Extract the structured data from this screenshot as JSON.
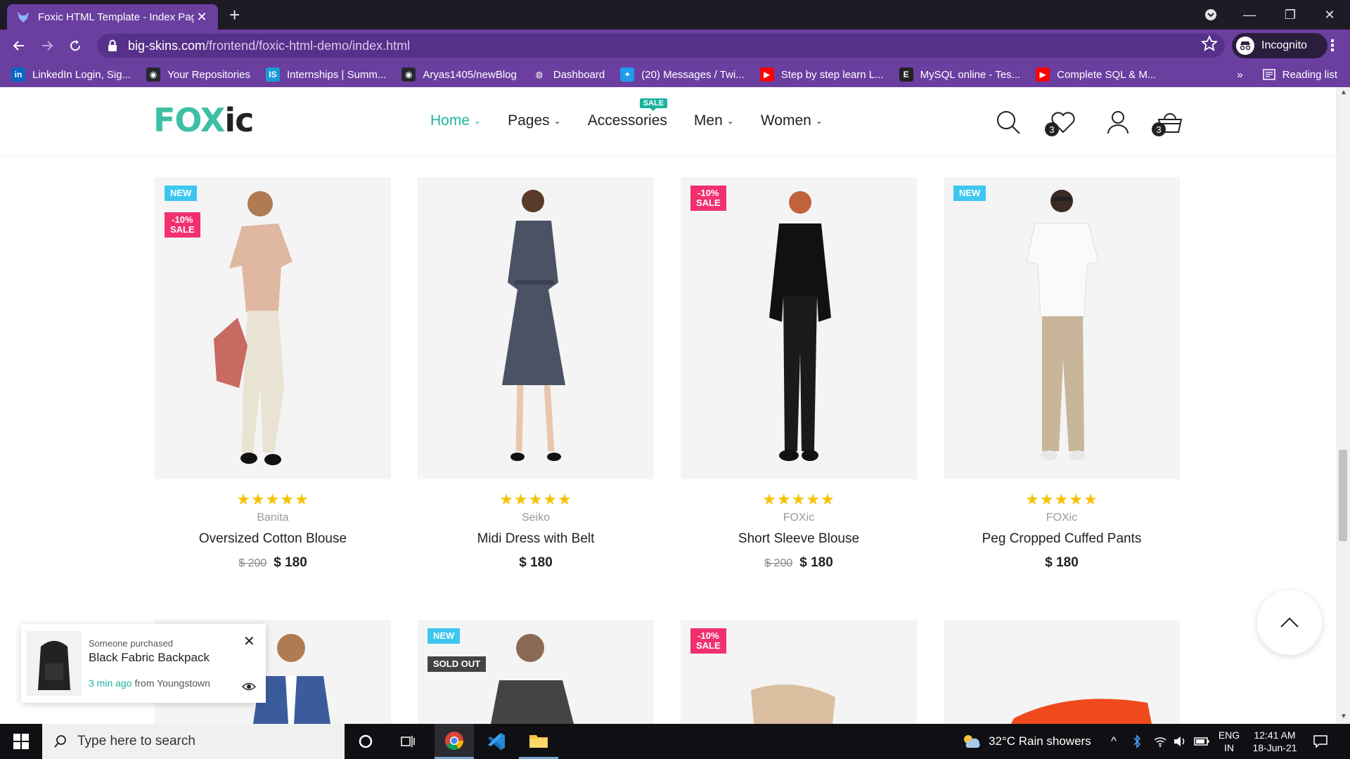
{
  "browser": {
    "tab_title": "Foxic HTML Template - Index Pag",
    "new_tab": "+",
    "url_domain": "big-skins.com",
    "url_path": "/frontend/foxic-html-demo/index.html",
    "profile": "Incognito",
    "reading_list": "Reading list",
    "bookmarks": [
      {
        "label": "LinkedIn Login, Sig...",
        "icon": "linkedin-icon",
        "color": "#0a66c2",
        "glyph": "in"
      },
      {
        "label": "Your Repositories",
        "icon": "github-icon",
        "color": "#24292e",
        "glyph": "◉"
      },
      {
        "label": "Internships | Summ...",
        "icon": "internshala-icon",
        "color": "#1b9ad8",
        "glyph": "IS"
      },
      {
        "label": "Aryas1405/newBlog",
        "icon": "github-icon",
        "color": "#24292e",
        "glyph": "◉"
      },
      {
        "label": "Dashboard",
        "icon": "globe-icon",
        "color": "#6a3fa0",
        "glyph": "◍"
      },
      {
        "label": "(20) Messages / Twi...",
        "icon": "twitter-icon",
        "color": "#1d9bf0",
        "glyph": "✦"
      },
      {
        "label": "Step by step learn L...",
        "icon": "youtube-icon",
        "color": "#ff0000",
        "glyph": "▶"
      },
      {
        "label": "MySQL online - Tes...",
        "icon": "e-icon",
        "color": "#222222",
        "glyph": "E"
      },
      {
        "label": "Complete SQL & M...",
        "icon": "youtube-icon",
        "color": "#ff0000",
        "glyph": "▶"
      }
    ]
  },
  "site": {
    "logo_fox": "FOX",
    "logo_ic": "ic",
    "menu": [
      {
        "label": "Home",
        "chevron": "⌄"
      },
      {
        "label": "Pages",
        "chevron": "⌄"
      },
      {
        "label": "Accessories",
        "chevron": ""
      },
      {
        "label": "Men",
        "chevron": "⌄"
      },
      {
        "label": "Women",
        "chevron": "⌄"
      }
    ],
    "sale_tag": "SALE",
    "wishlist_count": "3",
    "cart_count": "3",
    "accent_color": "#21b5a3"
  },
  "products": [
    {
      "badges": [
        "NEW",
        "-10%\nSALE"
      ],
      "stars": "★★★★★",
      "brand": "Banita",
      "name": "Oversized Cotton Blouse",
      "old_price": "$ 200",
      "price": "$ 180"
    },
    {
      "badges": [],
      "stars": "★★★★★",
      "brand": "Seiko",
      "name": "Midi Dress with Belt",
      "old_price": "",
      "price": "$ 180"
    },
    {
      "badges": [
        "-10%\nSALE"
      ],
      "stars": "★★★★★",
      "brand": "FOXic",
      "name": "Short Sleeve Blouse",
      "old_price": "$ 200",
      "price": "$ 180"
    },
    {
      "badges": [
        "NEW"
      ],
      "stars": "★★★★★",
      "brand": "FOXic",
      "name": "Peg Cropped Cuffed Pants",
      "old_price": "",
      "price": "$ 180"
    }
  ],
  "row2_badges": {
    "card2_new": "NEW",
    "card2_soldout": "SOLD OUT",
    "card3_sale": "-10%\nSALE"
  },
  "notification": {
    "small": "Someone purchased",
    "title": "Black Fabric Backpack",
    "time": "3 min ago",
    "location": "from Youngstown"
  },
  "taskbar": {
    "search_placeholder": "Type here to search",
    "weather": "32°C  Rain showers",
    "lang_top": "ENG",
    "lang_bottom": "IN",
    "time": "12:41 AM",
    "date": "18-Jun-21"
  }
}
